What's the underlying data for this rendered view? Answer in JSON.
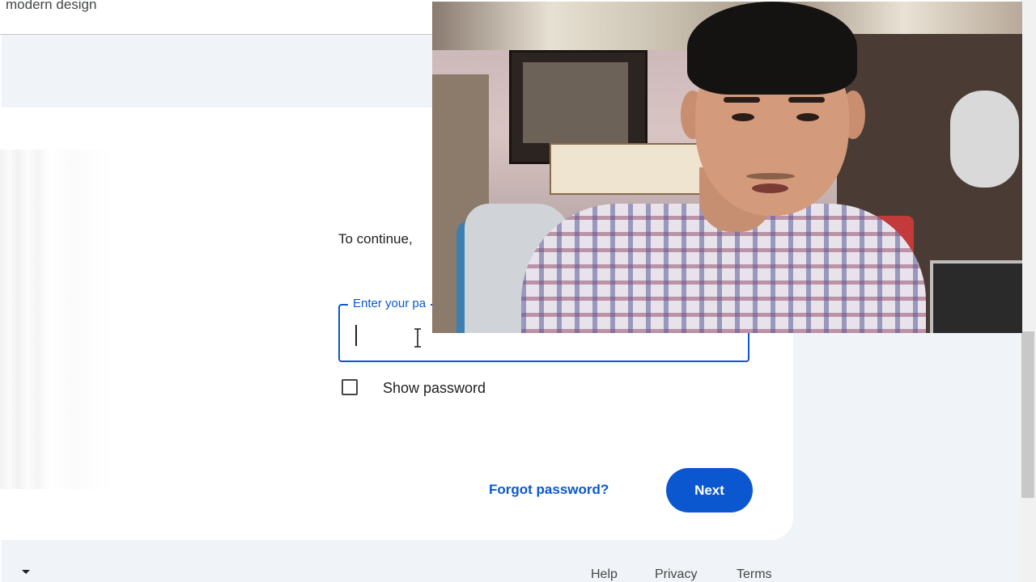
{
  "header": {
    "partial_text": "modern design"
  },
  "signin": {
    "subtitle": "To continue,",
    "password_label": "Enter your pa",
    "password_value": "",
    "show_password_label": "Show password",
    "show_password_checked": false,
    "forgot_label": "Forgot password?",
    "next_label": "Next"
  },
  "footer": {
    "help": "Help",
    "privacy": "Privacy",
    "terms": "Terms"
  },
  "webcam": {
    "description_icon": "webcam-overlay"
  },
  "colors": {
    "accent": "#0b57d0",
    "background": "#f0f4f9",
    "card": "#ffffff"
  }
}
